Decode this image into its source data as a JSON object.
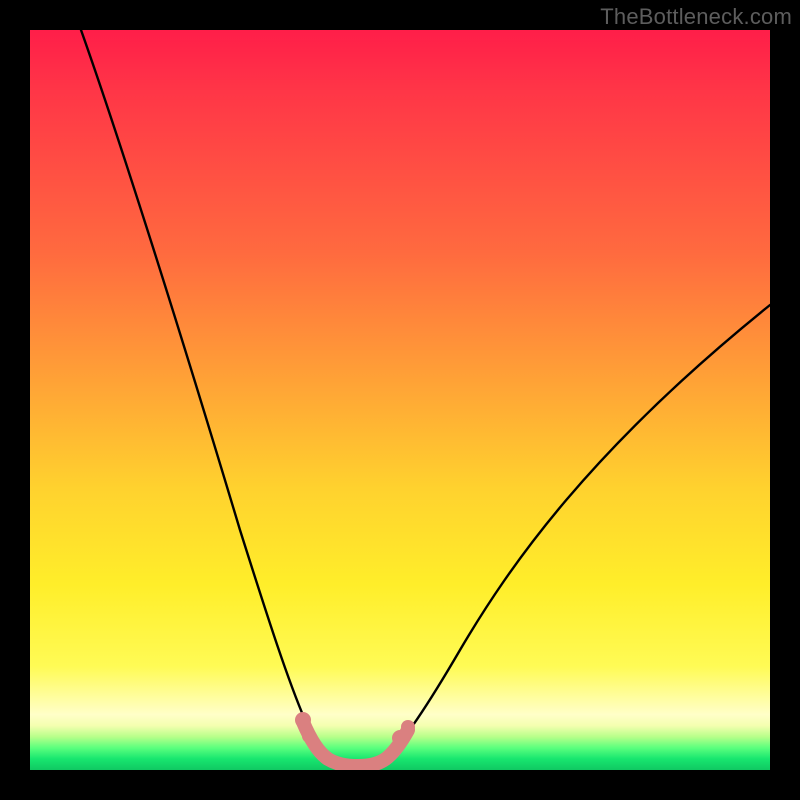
{
  "watermark": "TheBottleneck.com",
  "chart_data": {
    "type": "line",
    "title": "",
    "xlabel": "",
    "ylabel": "",
    "xlim": [
      0,
      100
    ],
    "ylim": [
      0,
      100
    ],
    "grid": false,
    "series": [
      {
        "name": "bottleneck-curve",
        "color": "#000000",
        "x": [
          7,
          10,
          14,
          18,
          22,
          26,
          30,
          32,
          34,
          36,
          37.5,
          39,
          40.5,
          42,
          44,
          46,
          48,
          50,
          54,
          58,
          63,
          70,
          78,
          88,
          100
        ],
        "values": [
          100,
          88,
          74,
          61,
          49,
          37,
          26,
          20,
          15,
          10,
          6,
          3,
          1.5,
          1,
          1,
          1.5,
          3,
          5.5,
          11,
          17,
          24,
          33,
          42,
          52,
          63
        ]
      },
      {
        "name": "valley-markers",
        "color": "#d97a7a",
        "type": "scatter",
        "x": [
          37.5,
          39,
          40.5,
          42,
          44,
          46,
          48,
          49.5
        ],
        "values": [
          6,
          3,
          1.5,
          1,
          1,
          1.5,
          3,
          5
        ]
      }
    ],
    "gradient_stops": [
      {
        "pos": 0,
        "color": "#ff1e49"
      },
      {
        "pos": 30,
        "color": "#ff6a3f"
      },
      {
        "pos": 62,
        "color": "#ffd22e"
      },
      {
        "pos": 86,
        "color": "#fffb55"
      },
      {
        "pos": 94,
        "color": "#f4ffb0"
      },
      {
        "pos": 100,
        "color": "#10c862"
      }
    ]
  }
}
